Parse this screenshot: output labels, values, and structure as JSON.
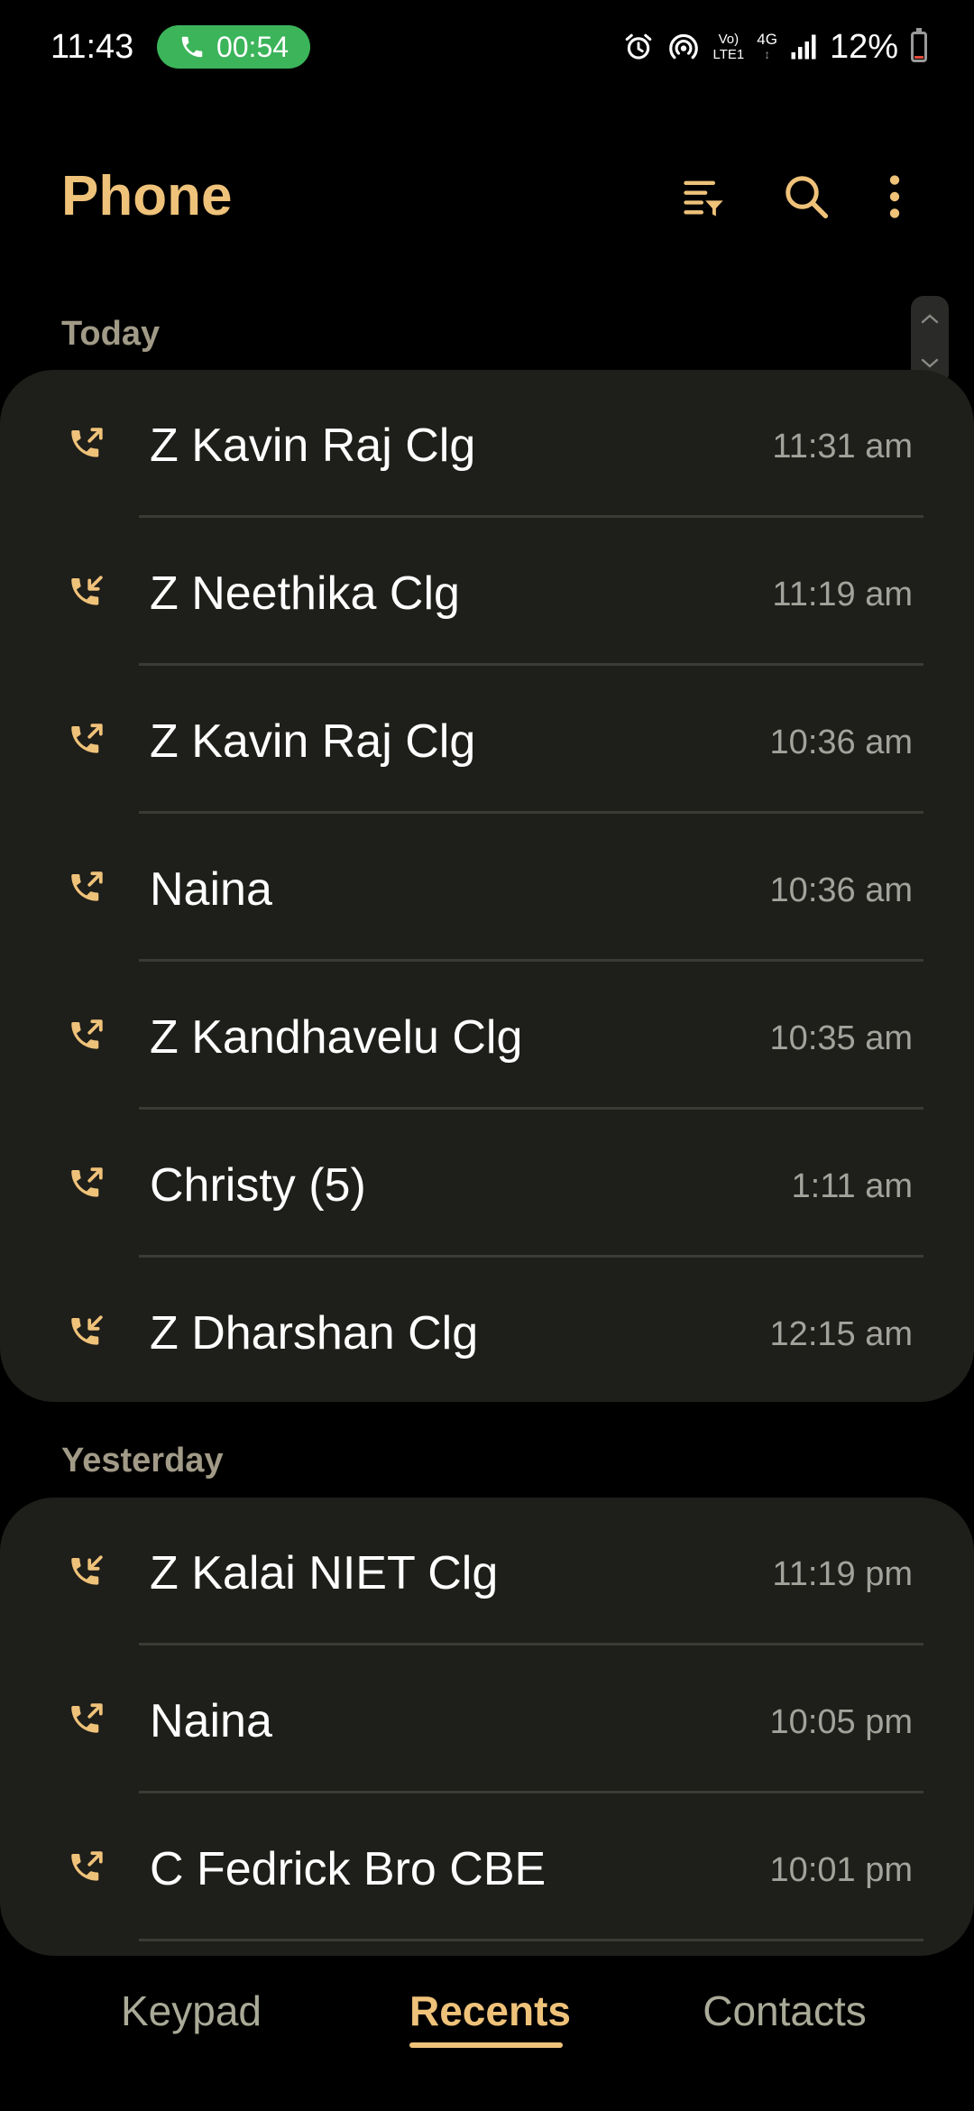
{
  "status_bar": {
    "time": "11:43",
    "call_timer": "00:54",
    "volte_top": "Vo)",
    "volte_bottom": "LTE1",
    "network": "4G",
    "battery_percent": "12%",
    "battery_level": 0.12,
    "call_pill_color": "#3cb45a",
    "icons": [
      "phone-icon",
      "alarm-icon",
      "hotspot-icon",
      "volte-icon",
      "network-4g-icon",
      "signal-icon",
      "battery-icon"
    ]
  },
  "app_bar": {
    "title": "Phone",
    "actions": [
      "filter-icon",
      "search-icon",
      "more-options-icon"
    ]
  },
  "theme": {
    "accent": "#efc27a",
    "card_bg": "#1e1e1a",
    "background": "#000000",
    "secondary_text": "#a3a39c"
  },
  "sections": [
    {
      "header": "Today",
      "calls": [
        {
          "name": "Z Kavin Raj Clg",
          "time": "11:31 am",
          "type": "outgoing"
        },
        {
          "name": "Z Neethika Clg",
          "time": "11:19 am",
          "type": "incoming"
        },
        {
          "name": "Z Kavin Raj Clg",
          "time": "10:36 am",
          "type": "outgoing"
        },
        {
          "name": "Naina",
          "time": "10:36 am",
          "type": "outgoing"
        },
        {
          "name": "Z Kandhavelu Clg",
          "time": "10:35 am",
          "type": "outgoing"
        },
        {
          "name": "Christy (5)",
          "time": "1:11 am",
          "type": "outgoing"
        },
        {
          "name": "Z Dharshan Clg",
          "time": "12:15 am",
          "type": "incoming"
        }
      ]
    },
    {
      "header": "Yesterday",
      "calls": [
        {
          "name": "Z Kalai NIET Clg",
          "time": "11:19 pm",
          "type": "incoming"
        },
        {
          "name": "Naina",
          "time": "10:05 pm",
          "type": "outgoing"
        },
        {
          "name": "C Fedrick Bro CBE",
          "time": "10:01 pm",
          "type": "outgoing"
        }
      ]
    }
  ],
  "bottom_nav": {
    "tabs": [
      {
        "label": "Keypad",
        "active": false
      },
      {
        "label": "Recents",
        "active": true
      },
      {
        "label": "Contacts",
        "active": false
      }
    ]
  }
}
